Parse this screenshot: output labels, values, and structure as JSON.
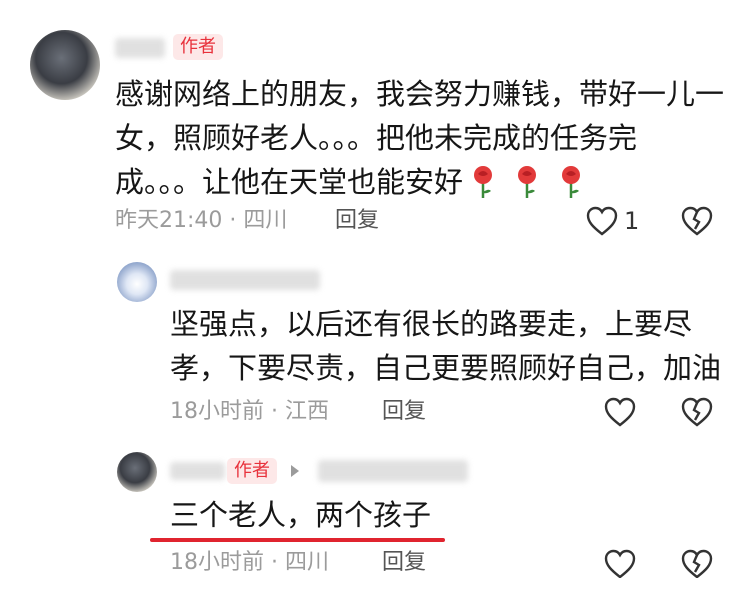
{
  "comment1": {
    "author_badge": "作者",
    "text_lines": [
      "感谢网络上的朋友，我会努力赚钱，带好一儿一",
      "女，照顾好老人。。。把他未完成的任务完",
      "成。。。让他在天堂也能安好"
    ],
    "time": "昨天21:40",
    "location": "四川",
    "reply_label": "回复",
    "like_count": "1"
  },
  "comment2": {
    "text_lines": [
      "坚强点，以后还有很长的路要走，上要尽",
      "孝，下要尽责，自己更要照顾好自己，加油"
    ],
    "time": "18小时前",
    "location": "江西",
    "reply_label": "回复"
  },
  "comment3": {
    "author_badge": "作者",
    "text": "三个老人，两个孩子",
    "time": "18小时前",
    "location": "四川",
    "reply_label": "回复"
  },
  "colors": {
    "accent_red": "#e0242f",
    "badge_bg": "#fde8e8",
    "meta_gray": "#9b9b9b"
  }
}
